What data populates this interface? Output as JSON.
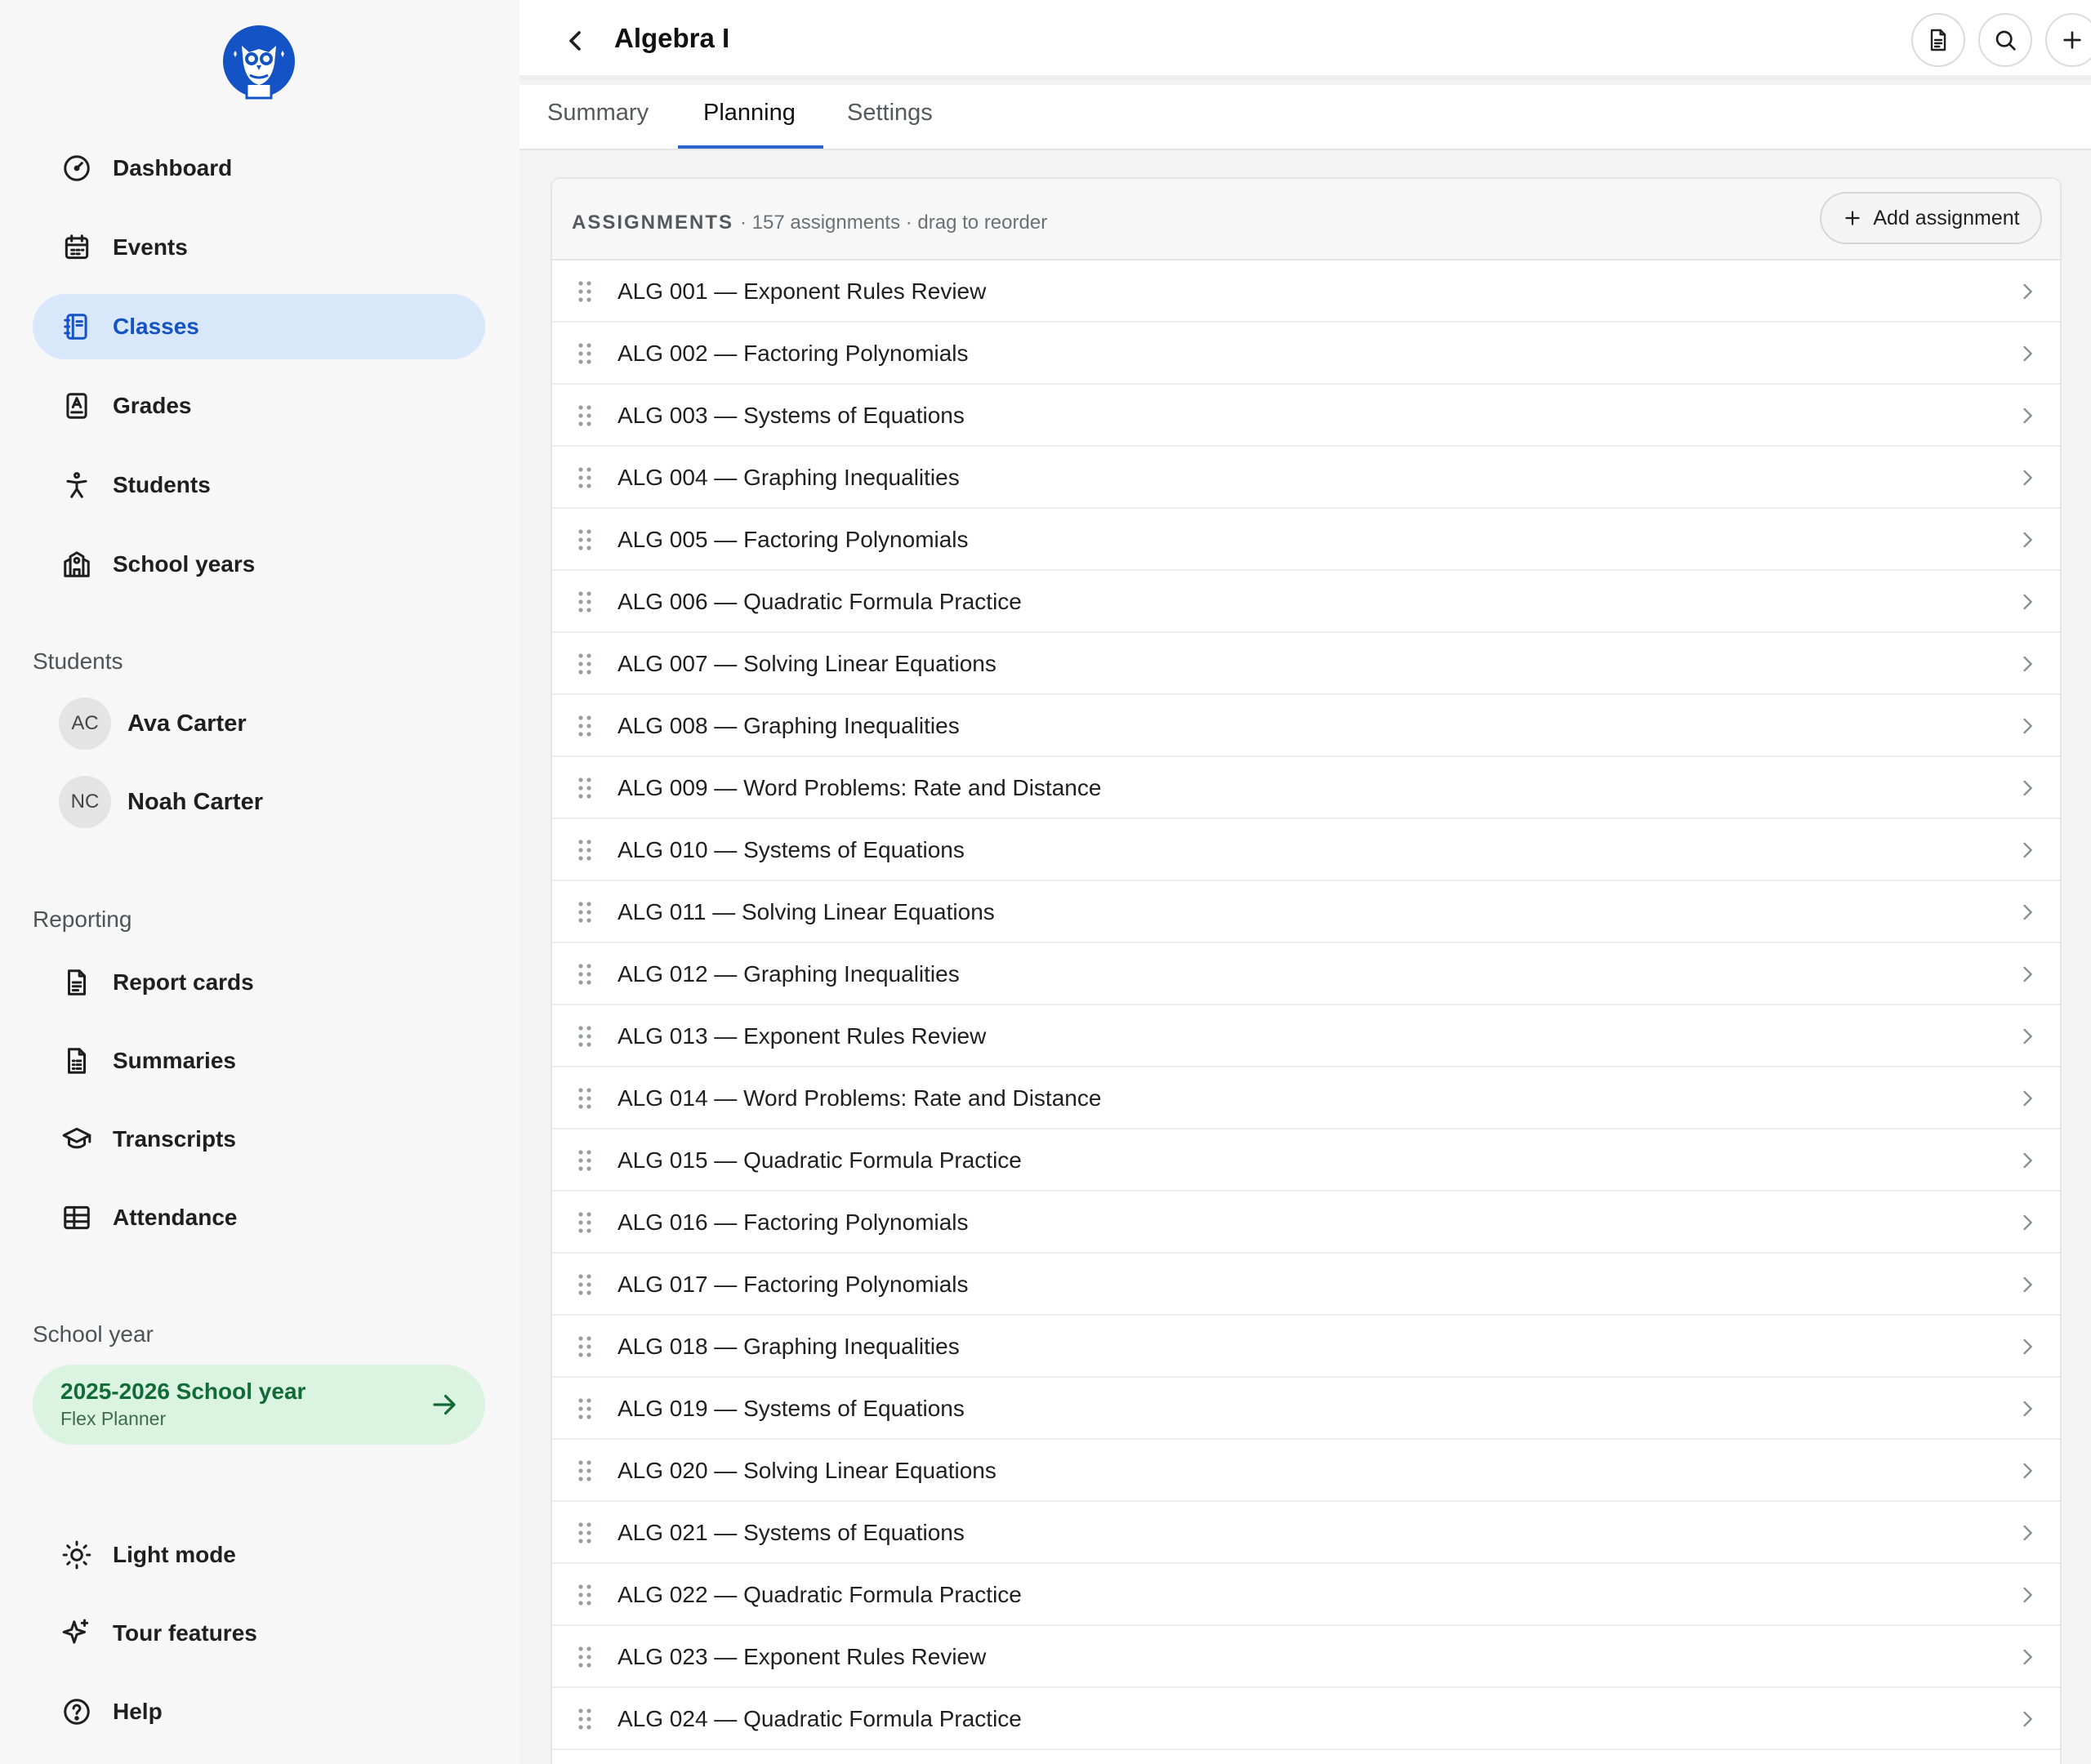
{
  "sidebar": {
    "nav": [
      {
        "label": "Dashboard",
        "icon": "gauge-icon"
      },
      {
        "label": "Events",
        "icon": "calendar-icon"
      },
      {
        "label": "Classes",
        "icon": "notebook-icon",
        "active": true
      },
      {
        "label": "Grades",
        "icon": "grade-book-icon"
      },
      {
        "label": "Students",
        "icon": "person-icon"
      },
      {
        "label": "School years",
        "icon": "school-icon"
      }
    ],
    "students_heading": "Students",
    "students": [
      {
        "initials": "AC",
        "name": "Ava Carter"
      },
      {
        "initials": "NC",
        "name": "Noah Carter"
      }
    ],
    "reporting_heading": "Reporting",
    "reporting": [
      {
        "label": "Report cards",
        "icon": "document-icon"
      },
      {
        "label": "Summaries",
        "icon": "summary-document-icon"
      },
      {
        "label": "Transcripts",
        "icon": "graduation-cap-icon"
      },
      {
        "label": "Attendance",
        "icon": "table-grid-icon"
      }
    ],
    "school_year_heading": "School year",
    "school_year": {
      "title": "2025-2026 School year",
      "subtitle": "Flex Planner"
    },
    "footer": [
      {
        "label": "Light mode",
        "icon": "sun-icon"
      },
      {
        "label": "Tour features",
        "icon": "sparkle-icon"
      },
      {
        "label": "Help",
        "icon": "question-circle-icon"
      }
    ]
  },
  "header": {
    "title": "Algebra I"
  },
  "tabs": [
    {
      "label": "Summary"
    },
    {
      "label": "Planning",
      "active": true
    },
    {
      "label": "Settings"
    }
  ],
  "assignments": {
    "heading": "ASSIGNMENTS",
    "meta": "· 157 assignments · drag to reorder",
    "add_label": "Add assignment",
    "items": [
      "ALG 001 — Exponent Rules Review",
      "ALG 002 — Factoring Polynomials",
      "ALG 003 — Systems of Equations",
      "ALG 004 — Graphing Inequalities",
      "ALG 005 — Factoring Polynomials",
      "ALG 006 — Quadratic Formula Practice",
      "ALG 007 — Solving Linear Equations",
      "ALG 008 — Graphing Inequalities",
      "ALG 009 — Word Problems: Rate and Distance",
      "ALG 010 — Systems of Equations",
      "ALG 011 — Solving Linear Equations",
      "ALG 012 — Graphing Inequalities",
      "ALG 013 — Exponent Rules Review",
      "ALG 014 — Word Problems: Rate and Distance",
      "ALG 015 — Quadratic Formula Practice",
      "ALG 016 — Factoring Polynomials",
      "ALG 017 — Factoring Polynomials",
      "ALG 018 — Graphing Inequalities",
      "ALG 019 — Systems of Equations",
      "ALG 020 — Solving Linear Equations",
      "ALG 021 — Systems of Equations",
      "ALG 022 — Quadratic Formula Practice",
      "ALG 023 — Exponent Rules Review",
      "ALG 024 — Quadratic Formula Practice"
    ]
  },
  "colors": {
    "accent": "#1353c6",
    "active_bg": "#d9e7fb",
    "school_year_bg": "#dbf4e2",
    "school_year_text": "#116b35"
  }
}
